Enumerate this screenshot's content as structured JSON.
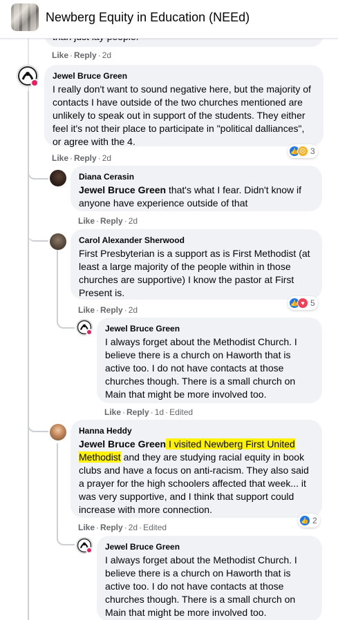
{
  "group": {
    "name": "Newberg Equity in Education (NEEd)"
  },
  "actions": {
    "like": "Like",
    "reply": "Reply",
    "dot": "·",
    "edited": "Edited"
  },
  "top_fragment": {
    "text": "than just lay people."
  },
  "comments": [
    {
      "author": "Jewel Bruce Green",
      "text": "I really don't want to sound negative here, but the majority of contacts I have outside of the two churches mentioned are unlikely to speak out in support of the students. They either feel it's not their place to participate in \"political dalliances\", or agree with the 4.",
      "time": "2d",
      "reactions": {
        "count": "3",
        "icons": [
          "like-icon",
          "sad-icon"
        ]
      }
    },
    {
      "author": "Diana Cerasin",
      "mention": "Jewel Bruce Green",
      "text": " that's what I fear. Didn't know if anyone have experience outside of that",
      "time": "2d"
    },
    {
      "author": "Carol Alexander Sherwood",
      "text": "First Presbyterian is a support as is First Methodist (at least a large majority of the people within in those churches are supportive) I know the pastor at First Present is.",
      "time": "2d",
      "reactions": {
        "count": "5",
        "icons": [
          "like-icon",
          "love-icon"
        ]
      }
    },
    {
      "author": "Jewel Bruce Green",
      "text": "I always forget about the Methodist Church. I believe there is a church on Haworth that is active too. I do not have contacts at those churches though. There is a small church on Main that might be more involved too.",
      "time": "1d",
      "edited": true
    },
    {
      "author": "Hanna Heddy",
      "mention": "Jewel Bruce Green",
      "highlight_1": " I visited Newberg First United",
      "highlight_2": "Methodist",
      "text": " and they are studying racial equity in book clubs and have a focus on anti-racism. They also said a prayer for the high schoolers affected that week... it was very supportive, and I think that support could increase with more connection.",
      "time": "2d",
      "edited": true,
      "reactions": {
        "count": "2",
        "icons": [
          "like-icon"
        ]
      }
    },
    {
      "author": "Jewel Bruce Green",
      "text": "I always forget about the Methodist Church. I believe there is a church on Haworth that is active too. I do not have contacts at those churches though. There is a small church on Main that might be more involved too."
    }
  ],
  "colors": {
    "accent": "#1877f2",
    "highlight": "#fff200",
    "bubble": "#f0f2f5",
    "meta": "#65676b"
  }
}
